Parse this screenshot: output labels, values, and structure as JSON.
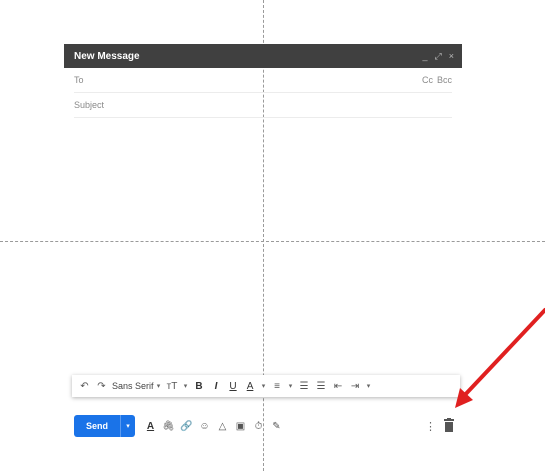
{
  "compose": {
    "title": "New Message",
    "controls": {
      "minimize": "_",
      "popout": "⤢",
      "close": "×"
    },
    "to_label": "To",
    "cc_label": "Cc",
    "bcc_label": "Bcc",
    "subject_placeholder": "Subject"
  },
  "toolbar": {
    "undo": "↶",
    "redo": "↷",
    "font": "Sans Serif",
    "caret": "▾",
    "size": "ᴛT",
    "bold": "B",
    "italic": "I",
    "underline": "U",
    "text_color": "A",
    "align": "≡",
    "numbered_list": "☰",
    "bulleted_list": "☰",
    "indent_less": "⇤",
    "indent_more": "⇥"
  },
  "bottom_bar": {
    "send_label": "Send",
    "send_caret": "▾",
    "formatting": "A",
    "attach": "🖇",
    "link": "🔗",
    "emoji": "☺",
    "drive": "△",
    "photo": "▣",
    "lock": "⏱",
    "signature": "✎",
    "more": "⋮"
  },
  "colors": {
    "title_bar": "#404040",
    "send_blue": "#1a73e8",
    "arrow_red": "#e02020"
  }
}
